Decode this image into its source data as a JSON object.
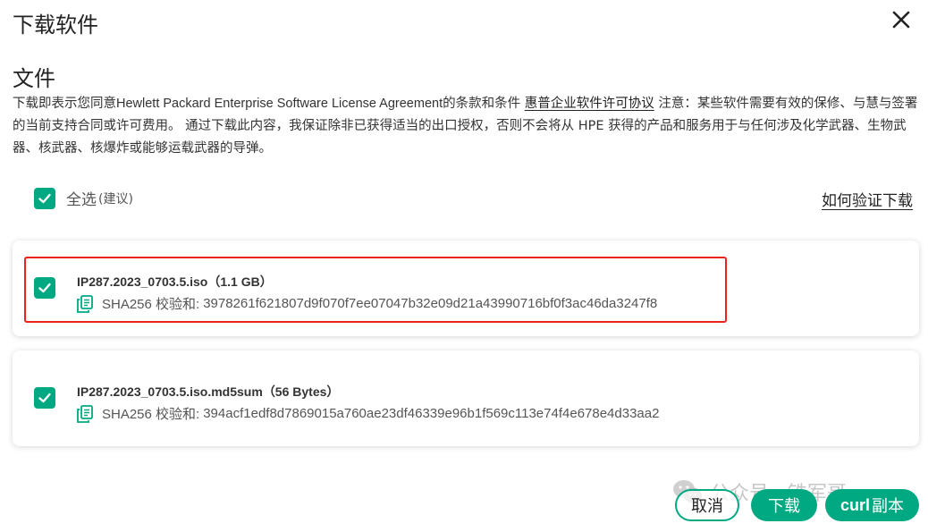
{
  "dialog": {
    "title": "下载软件",
    "close_label": "×"
  },
  "files_section": {
    "title": "文件",
    "legal_pre": "下载即表示您同意",
    "legal_en": "Hewlett Packard Enterprise Software License Agreement",
    "legal_mid": "的条款和条件 ",
    "legal_link": "惠普企业软件许可协议",
    "legal_post": " 注意：某些软件需要有效的保修、与慧与签署的当前支持合同或许可费用。 通过下载此内容，我保证除非已获得适当的出口授权，否则不会将从 HPE 获得的产品和服务用于与任何涉及化学武器、生物武器、核武器、核爆炸或能够运载武器的导弹。"
  },
  "select_all": {
    "label": "全选",
    "hint": "(建议)",
    "checked": true
  },
  "verify_link": "如何验证下载",
  "files": [
    {
      "name": "IP287.2023_0703.5.iso",
      "size": "（1.1 GB）",
      "hash_label": "SHA256 校验和:",
      "hash_value": "3978261f621807d9f070f7ee07047b32e09d21a43990716bf0f3ac46da3247f8",
      "checked": true
    },
    {
      "name": "IP287.2023_0703.5.iso.md5sum",
      "size": "（56 Bytes）",
      "hash_label": "SHA256 校验和:",
      "hash_value": "394acf1edf8d7869015a760ae23df46339e96b1f569c113e74f4e678e4d33aa2",
      "checked": true
    }
  ],
  "watermark": "公众号 · 铁军哥",
  "buttons": {
    "cancel": "取消",
    "download": "下载",
    "curl_prefix": "curl",
    "curl_suffix": "副本"
  },
  "colors": {
    "accent": "#01a982",
    "highlight": "#e8231c"
  }
}
